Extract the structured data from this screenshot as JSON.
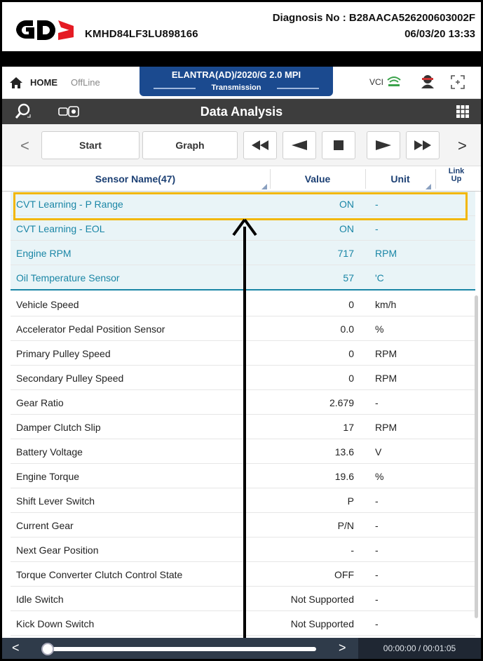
{
  "header": {
    "logo_text": "GDS",
    "vin": "KMHD84LF3LU898166",
    "diagnosis": "Diagnosis No : B28AACA526200603002F",
    "datetime": "06/03/20 13:33"
  },
  "homebar": {
    "home_label": "HOME",
    "offline_label": "OffLine",
    "vehicle_title": "ELANTRA(AD)/2020/G 2.0 MPI",
    "vehicle_sub": "Transmission",
    "vci_label": "VCI"
  },
  "titlebar": {
    "title": "Data Analysis"
  },
  "toolbar": {
    "prev_arrow": "<",
    "next_arrow": ">",
    "start_label": "Start",
    "graph_label": "Graph"
  },
  "columns": {
    "name": "Sensor Name(47)",
    "value": "Value",
    "unit": "Unit",
    "link_1": "Link",
    "link_2": "Up"
  },
  "pinned_rows": [
    {
      "name": "CVT Learning - P Range",
      "value": "ON",
      "unit": "-"
    },
    {
      "name": "CVT Learning - EOL",
      "value": "ON",
      "unit": "-"
    },
    {
      "name": "Engine RPM",
      "value": "717",
      "unit": "RPM"
    },
    {
      "name": "Oil Temperature Sensor",
      "value": "57",
      "unit": "'C"
    }
  ],
  "rows": [
    {
      "name": "Vehicle Speed",
      "value": "0",
      "unit": "km/h"
    },
    {
      "name": "Accelerator Pedal Position Sensor",
      "value": "0.0",
      "unit": "%"
    },
    {
      "name": "Primary Pulley Speed",
      "value": "0",
      "unit": "RPM"
    },
    {
      "name": "Secondary Pulley Speed",
      "value": "0",
      "unit": "RPM"
    },
    {
      "name": "Gear Ratio",
      "value": "2.679",
      "unit": "-"
    },
    {
      "name": "Damper Clutch Slip",
      "value": "17",
      "unit": "RPM"
    },
    {
      "name": "Battery Voltage",
      "value": "13.6",
      "unit": "V"
    },
    {
      "name": "Engine Torque",
      "value": "19.6",
      "unit": "%"
    },
    {
      "name": "Shift Lever Switch",
      "value": "P",
      "unit": "-"
    },
    {
      "name": "Current Gear",
      "value": "P/N",
      "unit": "-"
    },
    {
      "name": "Next Gear Position",
      "value": "-",
      "unit": "-"
    },
    {
      "name": "Torque Converter Clutch Control State",
      "value": "OFF",
      "unit": "-"
    },
    {
      "name": "Idle Switch",
      "value": "Not Supported",
      "unit": "-"
    },
    {
      "name": "Kick Down Switch",
      "value": "Not Supported",
      "unit": "-"
    }
  ],
  "playback": {
    "left_arrow": "<",
    "right_arrow": ">",
    "time": "00:00:00 / 00:01:05",
    "position_fraction": 0.0
  },
  "colors": {
    "highlight": "#f2b705",
    "pinned_text": "#1a86a6",
    "vehicle_tab": "#1b4a8f",
    "titlebar": "#3d3d3d"
  }
}
